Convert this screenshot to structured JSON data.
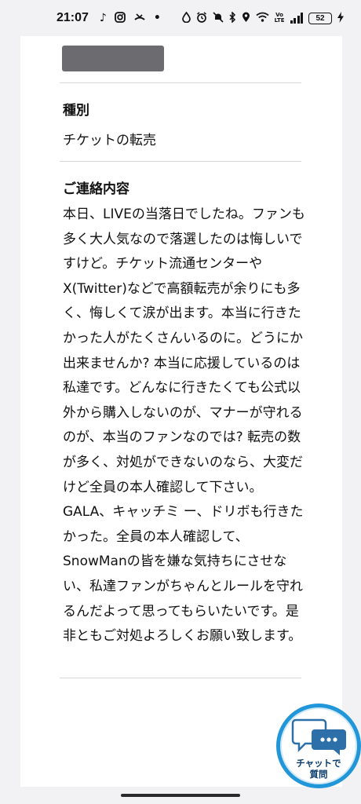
{
  "status_bar": {
    "time": "21:07",
    "battery": "52",
    "left_icons": [
      "tiktok-icon",
      "instagram-icon",
      "missed-call-icon",
      "dot-icon"
    ],
    "right_icons": [
      "water-drop-icon",
      "alarm-icon",
      "bell-off-icon",
      "bluetooth-icon",
      "location-icon",
      "wifi-icon",
      "volte-icon",
      "signal-icon",
      "battery-icon",
      "charging-icon"
    ]
  },
  "form": {
    "type_label": "種別",
    "type_value": "チケットの転売",
    "content_label": "ご連絡内容",
    "content_value": "本日、LIVEの当落日でしたね。ファンも多く大人気なので落選したのは悔しいですけど。チケット流通センターやX(Twitter)などで高額転売が余りにも多く、悔しくて涙が出ます。本当に行きたかった人がたくさんいるのに。どうにか出来ませんか? 本当に応援しているのは私達です。どんなに行きたくても公式以外から購入しないのが、マナーが守れるのが、本当のファンなのでは? 転売の数が多く、対処ができないのなら、大変だけど全員の本人確認して下さい。GALA、キャッチミ ー、ドリボも行きたかった。全員の本人確認して、SnowManの皆を嫌な気持ちにさせない、私達ファンがちゃんとルールを守れるんだよって思ってもらいたいです。是非ともご対処よろしくお願い致します。"
  },
  "chat_button": {
    "label": "チャットで\n質問"
  },
  "colors": {
    "accent": "#2196d8",
    "redacted": "#6c6c70"
  }
}
